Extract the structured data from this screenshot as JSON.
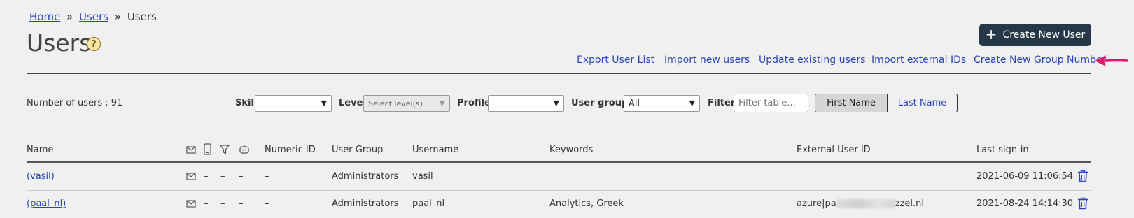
{
  "breadcrumb": {
    "home": "Home",
    "sep1": "»",
    "users_link": "Users",
    "sep2": "»",
    "current": "Users"
  },
  "page": {
    "title": "Users",
    "help": "?"
  },
  "create_button": {
    "plus": "+",
    "label": "Create New User"
  },
  "actions": {
    "export": "Export User List",
    "import": "Import new users",
    "update": "Update existing users",
    "import_ext": "Import external IDs",
    "create_group": "Create New Group Number"
  },
  "summary": {
    "count": "Number of users : 91"
  },
  "filters": {
    "skill_label": "Skill",
    "skill_value": "",
    "level_label": "Level",
    "level_value": "Select level(s)",
    "profile_label": "Profile",
    "profile_value": "",
    "group_label": "User group:",
    "group_value": "All",
    "filter_label": "Filter:",
    "filter_placeholder": "Filter table..."
  },
  "sort": {
    "first": "First Name",
    "last": "Last Name"
  },
  "columns": {
    "name": "Name",
    "numeric_id": "Numeric ID",
    "group": "User Group",
    "username": "Username",
    "keywords": "Keywords",
    "external_id": "External User ID",
    "last_signin": "Last sign-in"
  },
  "rows": [
    {
      "name": "(vasil)",
      "phone": "–",
      "filter": "–",
      "bot": "–",
      "numeric_id": "–",
      "group": "Administrators",
      "username": "vasil",
      "keywords": "",
      "external_prefix": "",
      "external_suffix": "",
      "last_signin": "2021-06-09 11:06:54"
    },
    {
      "name": "(paal_nl)",
      "phone": "–",
      "filter": "–",
      "bot": "–",
      "numeric_id": "–",
      "group": "Administrators",
      "username": "paal_nl",
      "keywords": "Analytics, Greek",
      "external_prefix": "azure|pa",
      "external_suffix": "zzel.nl",
      "last_signin": "2021-08-24 14:14:30"
    }
  ],
  "colors": {
    "accent": "#2a46b4",
    "button_dark": "#263847",
    "arrow": "#e0186c"
  },
  "icons": [
    "help-icon",
    "plus-icon",
    "arrow-left-icon",
    "mail-icon",
    "mobile-icon",
    "filter-icon",
    "bot-icon",
    "trash-icon",
    "chevron-down-icon"
  ]
}
